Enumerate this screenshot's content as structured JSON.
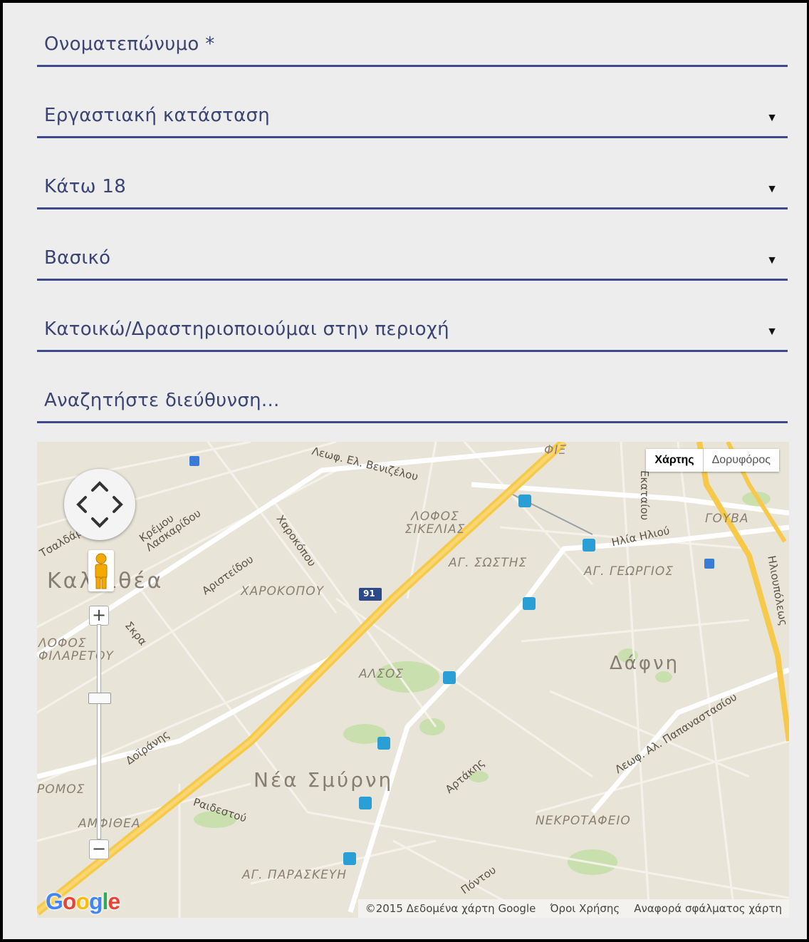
{
  "form": {
    "fields": [
      {
        "label": "Ονοματεπώνυμο *",
        "type": "input"
      },
      {
        "label": "Εργαστιακή κατάσταση",
        "type": "select"
      },
      {
        "label": "Κάτω 18",
        "type": "select"
      },
      {
        "label": "Βασικό",
        "type": "select"
      },
      {
        "label": "Κατοικώ/Δραστηριοποιούμαι στην περιοχή",
        "type": "select"
      },
      {
        "label": "Αναζητήστε διεύθυνση...",
        "type": "input"
      }
    ],
    "arrow_glyph": "▼",
    "accent_color": "#3d4a8c"
  },
  "map": {
    "map_type": {
      "map": "Χάρτης",
      "satellite": "Δορυφόρος"
    },
    "zoom_in": "+",
    "zoom_out": "−",
    "logo": "Google",
    "attribution": {
      "data": "©2015 Δεδομένα χάρτη Google",
      "terms": "Όροι Χρήσης",
      "report": "Αναφορά σφάλματος χάρτη"
    },
    "labels": {
      "kallithea": "Καλλιθέα",
      "nea_smyrni": "Νέα Σμύρνη",
      "dafni": "Δάφνη",
      "lofos_sikelias": "ΛΟΦΟΣ ΣΙΚΕΛΙΑΣ",
      "ag_sostis": "ΑΓ. ΣΩΣΤΗΣ",
      "ag_georgios": "ΑΓ. ΓΕΩΡΓΙΟΣ",
      "charokopou_area": "ΧΑΡΟΚΟΠΟΥ",
      "lofos_filaretou": "ΛΟΦΟΣ ΦΙΛΑΡΕΤΟΥ",
      "alsos": "ΑΛΣΟΣ",
      "goyva": "ΓΟΥΒΑ",
      "dromos": "ΡΟΜΟΣ",
      "amfithea": "ΑΜΦΙΘΕΑ",
      "nekrotafeio": "ΝΕΚΡΟΤΑΦΕΙΟ",
      "ag_paraskevi": "ΑΓ. ΠΑΡΑΣΚΕΥΗ",
      "venizelou": "Λεωφ. Ελ. Βενιζέλου",
      "charokopou": "Χαροκόπου",
      "aristeidou": "Αριστείδου",
      "kremou": "Κρέμου Λασκαρίδου",
      "tsaldari": "Τσαλδάρη",
      "skra": "Σκρα",
      "doiranis": "Δοϊράνης",
      "raidestou": "Ραιδεστού",
      "artakis": "Αρτάκης",
      "pontou": "Πόντου",
      "ilia_iliou": "Ηλία Ηλιού",
      "ekataiou": "Εκαταίου",
      "iliopoleos": "Ηλιουπόλεως",
      "papanastasiou": "Λεωφ. Αλ. Παπαναστασίου",
      "route_91": "91",
      "fix": "ΦΙΞ"
    }
  }
}
